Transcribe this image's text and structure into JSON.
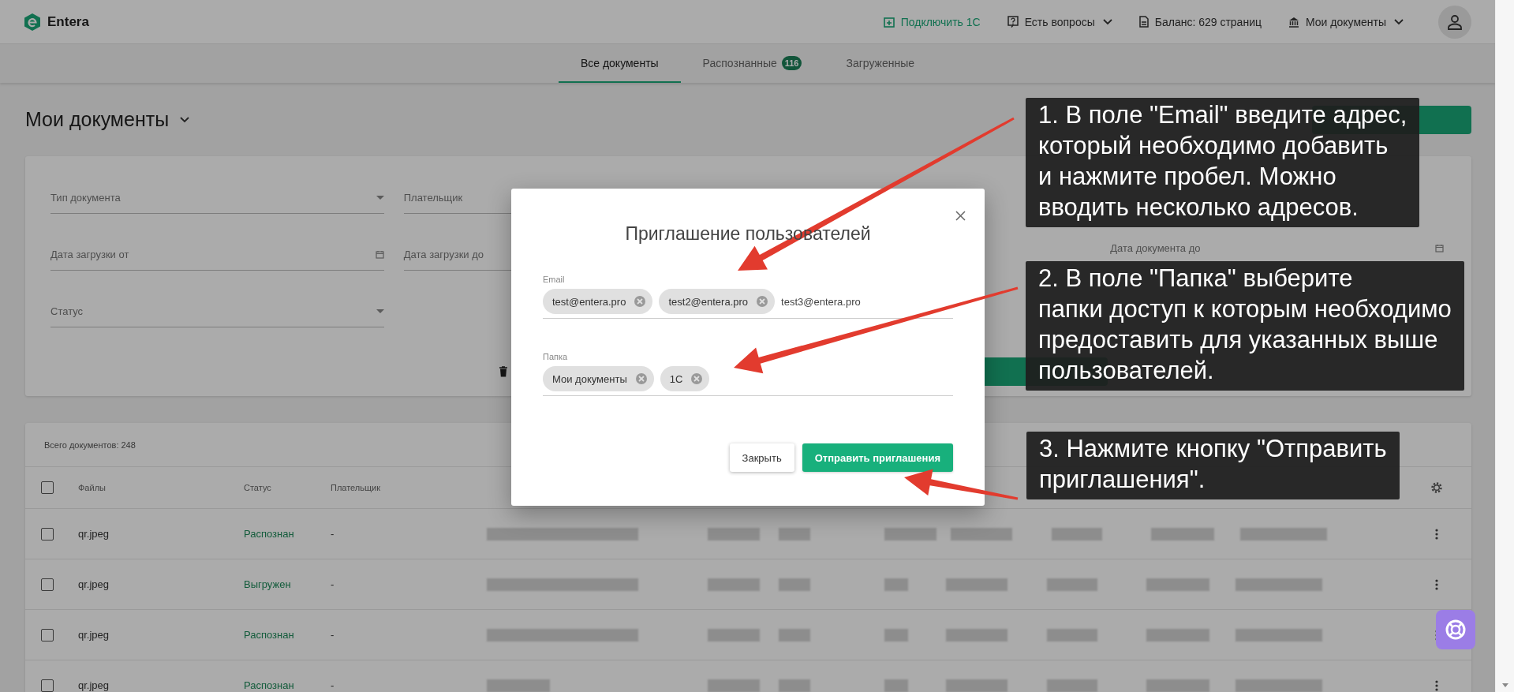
{
  "header": {
    "logo": "Entera",
    "actions": [
      {
        "kind": "connect",
        "label": "Подключить 1С",
        "has_menu": false
      },
      {
        "kind": "help",
        "label": "Есть вопросы",
        "has_menu": true
      },
      {
        "kind": "balance",
        "label": "Баланс: 629 страниц",
        "has_menu": false
      },
      {
        "kind": "folders",
        "label": "Мои документы",
        "has_menu": true
      }
    ]
  },
  "tabs": [
    {
      "label": "Все документы",
      "selected": true
    },
    {
      "label": "Распознанные",
      "selected": false,
      "badge": "116"
    },
    {
      "label": "Загруженные",
      "selected": false
    }
  ],
  "page_title": "Мои документы",
  "filters": {
    "left": [
      {
        "kind": "select",
        "placeholder": "Тип документа"
      },
      {
        "kind": "select",
        "placeholder": "Плательщик"
      },
      {
        "kind": "date",
        "placeholder": "Дата загрузки от"
      },
      {
        "kind": "date",
        "placeholder": "Дата загрузки до"
      },
      {
        "kind": "select",
        "placeholder": "Статус"
      }
    ],
    "right": [
      {
        "kind": "date",
        "placeholder": "Дата документа до"
      }
    ]
  },
  "table": {
    "total": "Всего документов: 248",
    "all_checked": false,
    "columns": [
      "Файлы",
      "Статус",
      "Плательщик"
    ],
    "rows": [
      {
        "checked": false,
        "file": "qr.jpeg",
        "status": "Распознан",
        "payer": "-"
      },
      {
        "checked": false,
        "file": "qr.jpeg",
        "status": "Выгружен",
        "payer": "-"
      },
      {
        "checked": false,
        "file": "qr.jpeg",
        "status": "Распознан",
        "payer": "-"
      },
      {
        "checked": false,
        "file": "qr.jpeg",
        "status": "Распознан",
        "payer": "-"
      }
    ]
  },
  "dialog": {
    "title": "Приглашение пользователей",
    "email": {
      "label": "Email",
      "chips": [
        "test@entera.pro",
        "test2@entera.pro"
      ],
      "value": "test3@entera.pro"
    },
    "folder": {
      "label": "Папка",
      "chips": [
        "Мои документы",
        "1С"
      ]
    },
    "buttons": [
      {
        "kind": "secondary",
        "label": "Закрыть"
      },
      {
        "kind": "primary",
        "label": "Отправить приглашения"
      }
    ]
  },
  "annotations": [
    "1. В поле \"Email\" введите адрес,\nкоторый необходимо добавить\nи нажмите пробел. Можно\nвводить несколько адресов.",
    "2. В поле \"Папка\" выберите\nпапки доступ к которым необходимо\nпредоставить для указанных выше\nпользователей.",
    "3. Нажмите кнопку \"Отправить\nприглашения\"."
  ]
}
